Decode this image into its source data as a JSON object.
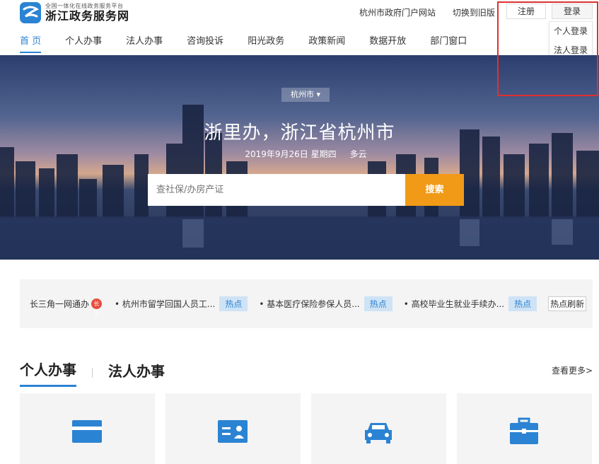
{
  "logo": {
    "subtitle": "全国一体化在线政务服务平台",
    "title": "浙江政务服务网"
  },
  "top_links": [
    "杭州市政府门户网站",
    "切换到旧版"
  ],
  "auth": {
    "register": "注册",
    "login": "登录",
    "menu": [
      "个人登录",
      "法人登录"
    ]
  },
  "nav": [
    "首 页",
    "个人办事",
    "法人办事",
    "咨询投诉",
    "阳光政务",
    "政策新闻",
    "数据开放",
    "部门窗口"
  ],
  "hero": {
    "city": "杭州市",
    "title": "浙里办，浙江省杭州市",
    "date": "2019年9月26日  星期四",
    "weather": "多云"
  },
  "search": {
    "placeholder": "查社保/办房产证",
    "button": "搜索"
  },
  "hotbar": {
    "title": "长三角一网通办",
    "badge": "长三",
    "items": [
      "杭州市留学回国人员工...",
      "基本医疗保险参保人员...",
      "高校毕业生就业手续办..."
    ],
    "tag": "热点",
    "refresh": "热点刷新"
  },
  "tabs": [
    "个人办事",
    "法人办事"
  ],
  "more": "查看更多>",
  "cards": [
    {
      "icon": "credit-card-icon"
    },
    {
      "icon": "id-card-icon"
    },
    {
      "icon": "car-icon"
    },
    {
      "icon": "briefcase-icon"
    }
  ],
  "colors": {
    "accent": "#2b83d3",
    "search_button": "#f19a17",
    "highlight_box": "#e03030"
  }
}
